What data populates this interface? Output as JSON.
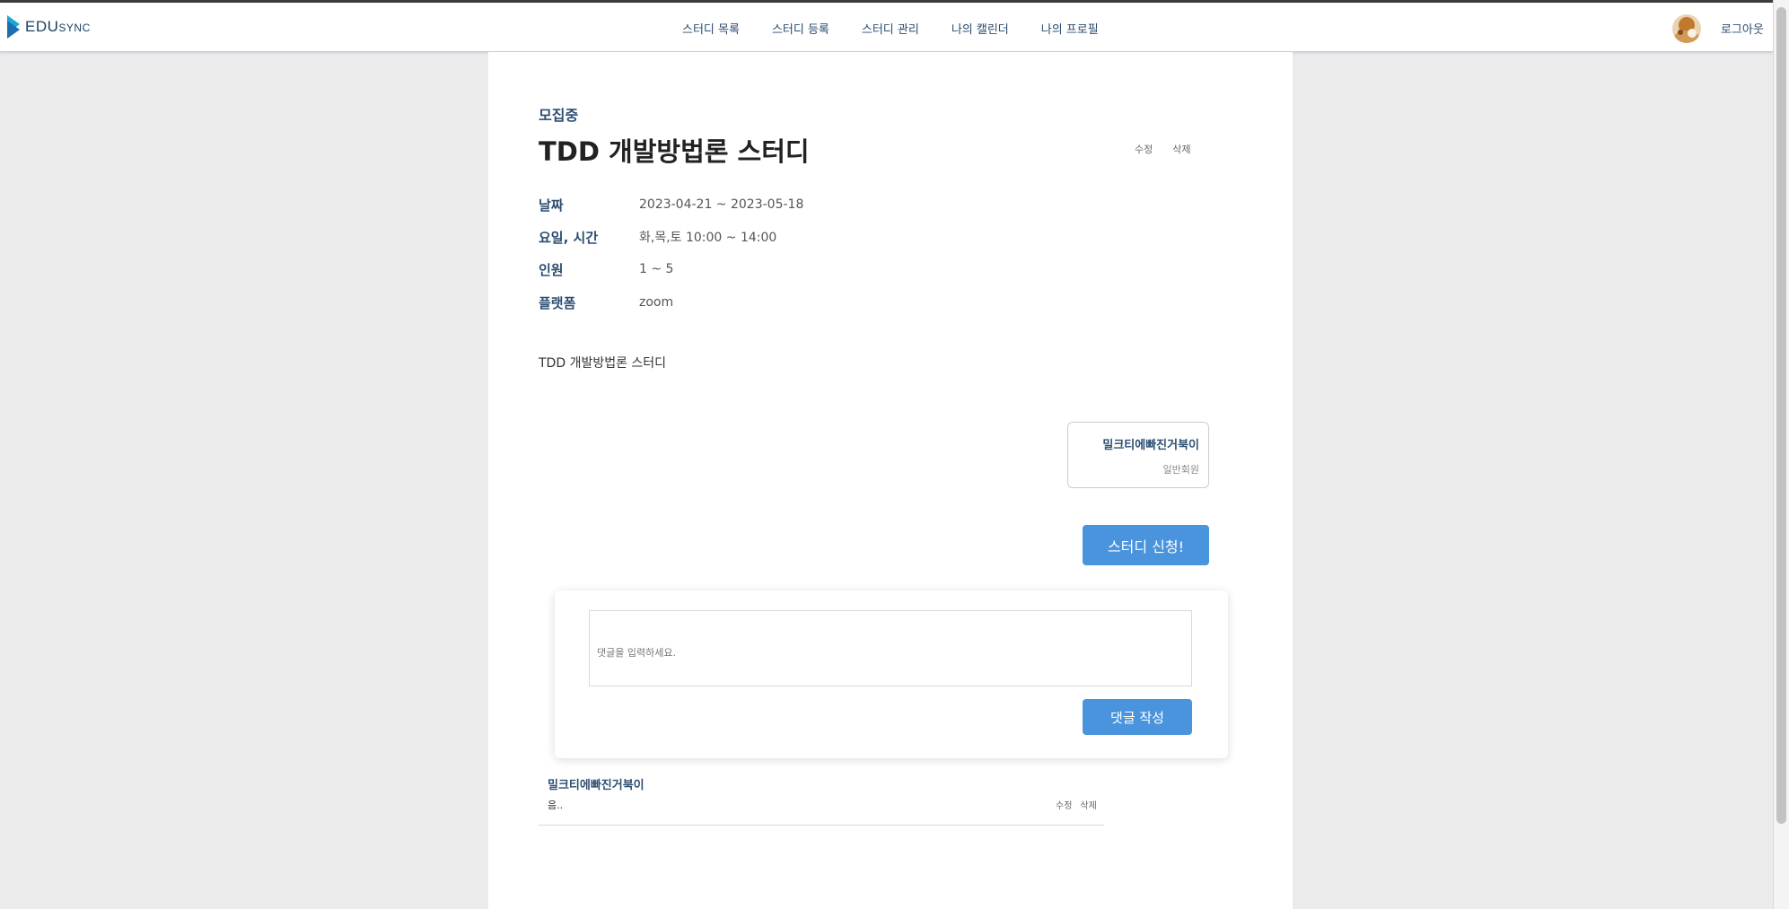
{
  "header": {
    "logo_main": "EDU",
    "logo_sub": "SYNC",
    "nav": [
      {
        "label": "스터디 목록"
      },
      {
        "label": "스터디 등록"
      },
      {
        "label": "스터디 관리"
      },
      {
        "label": "나의 캘린더"
      },
      {
        "label": "나의 프로필"
      }
    ],
    "logout_label": "로그아웃"
  },
  "study": {
    "status": "모집중",
    "title": "TDD 개발방법론 스터디",
    "edit_label": "수정",
    "delete_label": "삭제",
    "info": [
      {
        "label": "날짜",
        "value": "2023-04-21 ~ 2023-05-18"
      },
      {
        "label": "요일, 시간",
        "value": "화,목,토 10:00 ~ 14:00"
      },
      {
        "label": "인원",
        "value": "1 ~ 5"
      },
      {
        "label": "플랫폼",
        "value": "zoom"
      }
    ],
    "description": "TDD 개발방법론 스터디",
    "member": {
      "name": "밀크티에빠진거북이",
      "role": "일반회원"
    },
    "apply_label": "스터디 신청!"
  },
  "comment_form": {
    "placeholder": "댓글을 입력하세요.",
    "submit_label": "댓글 작성"
  },
  "comments": [
    {
      "author": "밀크티에빠진거북이",
      "text": "음..",
      "edit_label": "수정",
      "delete_label": "삭제"
    }
  ],
  "colors": {
    "accent": "#4a94de",
    "brand_text": "#2d4e72",
    "page_bg": "#ebebeb"
  }
}
